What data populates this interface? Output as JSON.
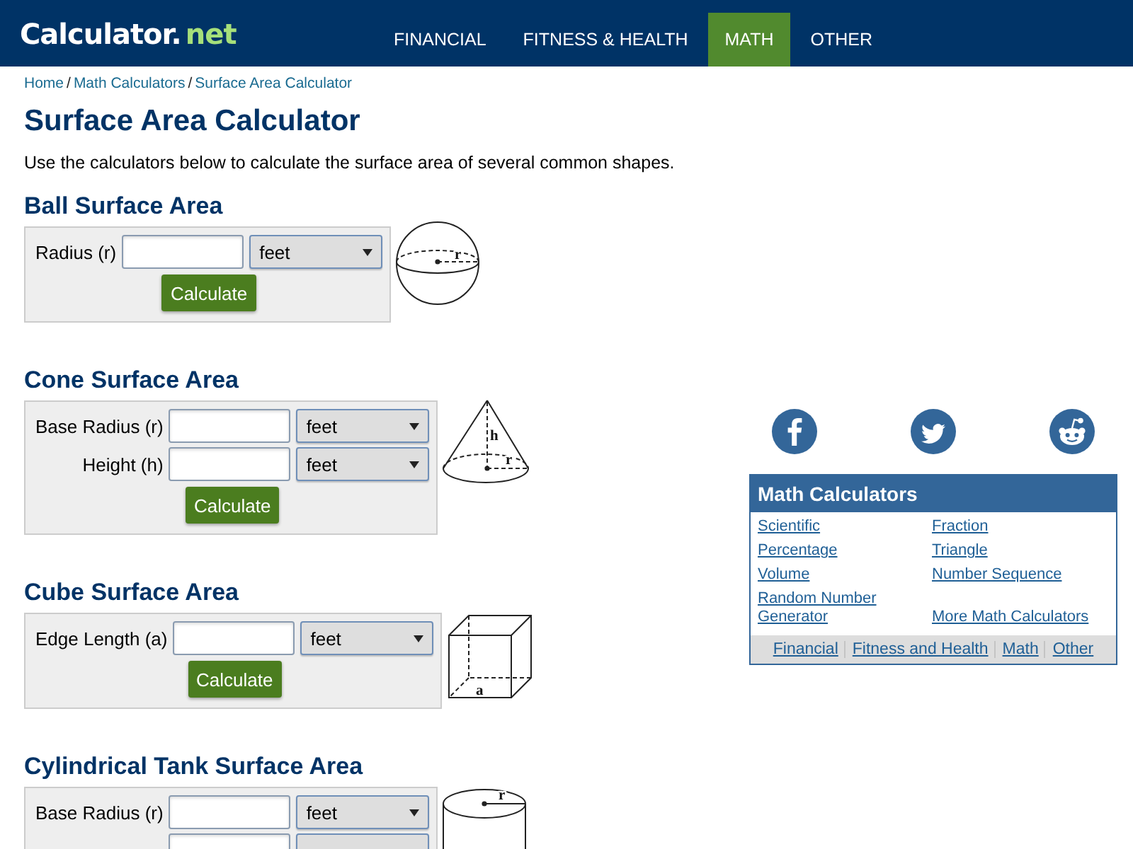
{
  "header": {
    "logo": {
      "main": "Calculator.",
      "accent": "net"
    },
    "nav": [
      {
        "label": "FINANCIAL",
        "selected": false
      },
      {
        "label": "FITNESS & HEALTH",
        "selected": false
      },
      {
        "label": "MATH",
        "selected": true
      },
      {
        "label": "OTHER",
        "selected": false
      }
    ]
  },
  "breadcrumb": [
    {
      "kind": "link",
      "text": "Home"
    },
    {
      "kind": "separator",
      "text": "/"
    },
    {
      "kind": "link",
      "text": "Math Calculators"
    },
    {
      "kind": "separator",
      "text": "/"
    },
    {
      "kind": "link",
      "text": "Surface Area Calculator"
    }
  ],
  "title": "Surface Area Calculator",
  "intro": "Use the calculators below to calculate the surface area of several common shapes.",
  "calculators": [
    {
      "title": "Ball Surface Area",
      "rows": [
        {
          "label": "Radius (r)",
          "unit": "feet"
        }
      ],
      "button": "Calculate",
      "diagram": {
        "kind": "sphere",
        "labels": [
          "r"
        ]
      }
    },
    {
      "title": "Cone Surface Area",
      "rows": [
        {
          "label": "Base Radius (r)",
          "unit": "feet"
        },
        {
          "label": "Height (h)",
          "unit": "feet"
        }
      ],
      "button": "Calculate",
      "diagram": {
        "kind": "cone",
        "labels": [
          "h",
          "r"
        ]
      }
    },
    {
      "title": "Cube Surface Area",
      "rows": [
        {
          "label": "Edge Length (a)",
          "unit": "feet"
        }
      ],
      "button": "Calculate",
      "diagram": {
        "kind": "cube",
        "labels": [
          "a"
        ]
      }
    },
    {
      "title": "Cylindrical Tank Surface Area",
      "rows": [
        {
          "label": "Base Radius (r)",
          "unit": "feet"
        },
        {}
      ],
      "diagram": {
        "kind": "cylinder",
        "labels": [
          "r"
        ]
      }
    }
  ],
  "sidebar": {
    "share": [
      {
        "kind": "facebook"
      },
      {
        "kind": "twitter"
      },
      {
        "kind": "reddit"
      }
    ],
    "panel": {
      "title": "Math Calculators",
      "links": [
        "Scientific",
        "Fraction",
        "Percentage",
        "Triangle",
        "Volume",
        "Number Sequence",
        "Random Number Generator",
        "More Math Calculators"
      ],
      "categories": [
        "Financial",
        "Fitness and Health",
        "Math",
        "Other"
      ]
    }
  }
}
